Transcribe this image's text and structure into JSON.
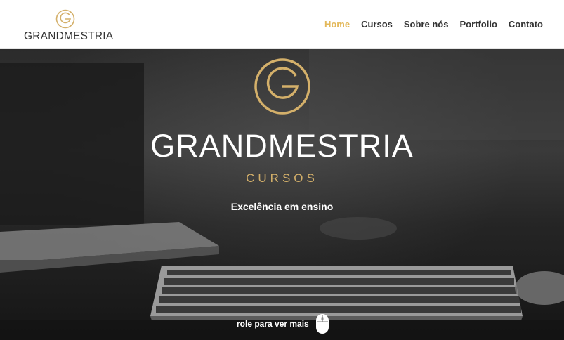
{
  "header": {
    "logo_text": "GRANDMESTRIA",
    "nav": [
      {
        "label": "Home",
        "active": true
      },
      {
        "label": "Cursos",
        "active": false
      },
      {
        "label": "Sobre nós",
        "active": false
      },
      {
        "label": "Portfolio",
        "active": false
      },
      {
        "label": "Contato",
        "active": false
      }
    ]
  },
  "hero": {
    "title": "GRANDMESTRIA",
    "subtitle": "CURSOS",
    "tagline": "Excelência em ensino",
    "scroll_hint": "role para ver mais"
  },
  "colors": {
    "accent": "#e3b85a",
    "gold": "#d4b06a",
    "nav_text": "#333333"
  },
  "icons": [
    "logo-g-icon",
    "mouse-scroll-icon"
  ]
}
